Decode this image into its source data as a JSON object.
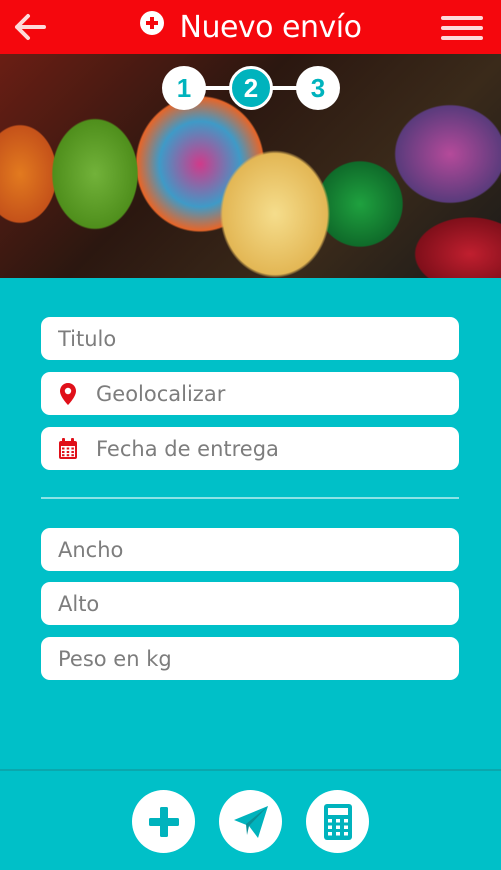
{
  "header": {
    "title": "Nuevo envío",
    "back_icon": "arrow-left-icon",
    "title_icon": "plus-circle-icon",
    "menu_icon": "hamburger-menu-icon"
  },
  "steps": [
    {
      "label": "1",
      "active": false
    },
    {
      "label": "2",
      "active": true
    },
    {
      "label": "3",
      "active": false
    }
  ],
  "form": {
    "title_placeholder": "Titulo",
    "geo_placeholder": "Geolocalizar",
    "date_placeholder": "Fecha de entrega",
    "width_placeholder": "Ancho",
    "height_placeholder": "Alto",
    "weight_placeholder": "Peso en kg"
  },
  "actions": [
    {
      "icon": "plus-icon"
    },
    {
      "icon": "paper-plane-icon"
    },
    {
      "icon": "calculator-icon"
    }
  ],
  "colors": {
    "header_red": "#f5070d",
    "teal": "#00c0c8",
    "icon_red": "#e0101a"
  }
}
